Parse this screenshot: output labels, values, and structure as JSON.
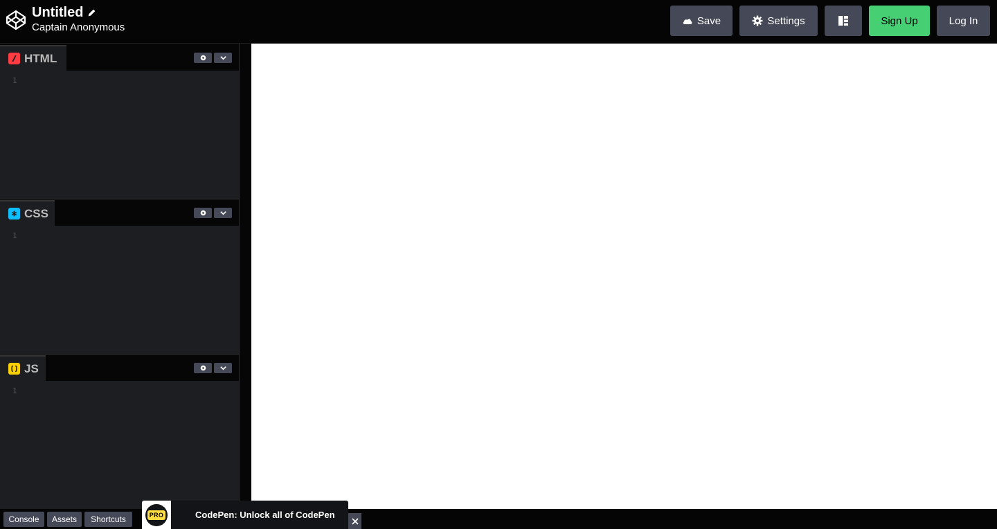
{
  "header": {
    "pen_title": "Untitled",
    "owner": "Captain Anonymous",
    "buttons": {
      "save": "Save",
      "settings": "Settings",
      "signup": "Sign Up",
      "login": "Log In"
    },
    "icons": {
      "logo": "codepen-logo-icon",
      "edit": "pencil-icon",
      "save": "cloud-icon",
      "settings": "gear-icon",
      "layout": "layout-icon"
    }
  },
  "editors": [
    {
      "label": "HTML",
      "icon": "html-slash-icon",
      "color": "#ff3c41",
      "line_number": "1"
    },
    {
      "label": "CSS",
      "icon": "css-asterisk-icon",
      "color": "#0ebeff",
      "line_number": "1"
    },
    {
      "label": "JS",
      "icon": "js-braces-icon",
      "color": "#fcd000",
      "line_number": "1"
    }
  ],
  "footer": {
    "console": "Console",
    "assets": "Assets",
    "shortcuts": "Shortcuts"
  },
  "promo": {
    "badge": "PRO",
    "text": "CodePen: Unlock all of CodePen"
  },
  "colors": {
    "accent_green": "#47cf73",
    "button_gray": "#444857",
    "editor_bg": "#1d1e22"
  }
}
